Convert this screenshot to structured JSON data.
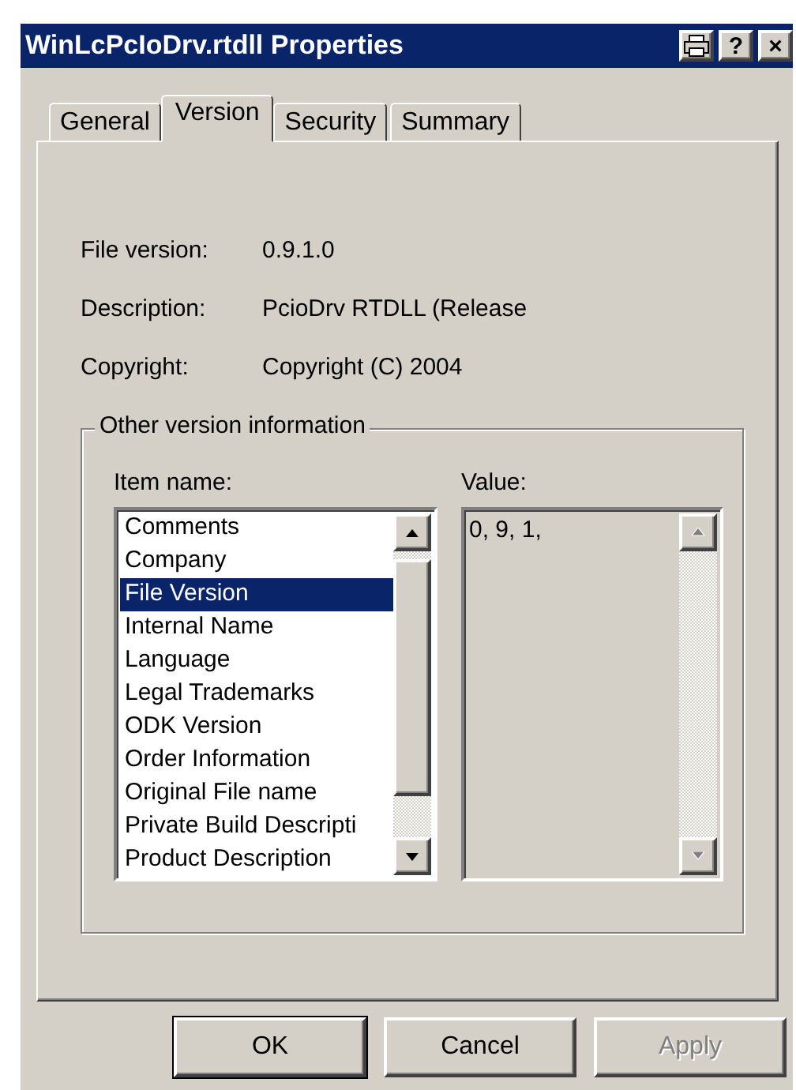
{
  "window": {
    "title": "WinLcPcIoDrv.rtdll Properties",
    "title_buttons": [
      "?",
      "×"
    ]
  },
  "tabs": [
    {
      "label": "General",
      "selected": false
    },
    {
      "label": "Version",
      "selected": true
    },
    {
      "label": "Security",
      "selected": false
    },
    {
      "label": "Summary",
      "selected": false
    }
  ],
  "fields": [
    {
      "label": "File version:",
      "value": "0.9.1.0"
    },
    {
      "label": "Description:",
      "value": "PcioDrv RTDLL (Release"
    },
    {
      "label": "Copyright:",
      "value": "Copyright (C) 2004"
    }
  ],
  "other_info": {
    "title": "Other version information",
    "item_label": "Item name:",
    "value_label": "Value:",
    "items": [
      {
        "label": "Comments",
        "selected": false
      },
      {
        "label": "Company",
        "selected": false
      },
      {
        "label": "File Version",
        "selected": true
      },
      {
        "label": "Internal Name",
        "selected": false
      },
      {
        "label": "Language",
        "selected": false
      },
      {
        "label": "Legal Trademarks",
        "selected": false
      },
      {
        "label": "ODK Version",
        "selected": false
      },
      {
        "label": "Order Information",
        "selected": false
      },
      {
        "label": "Original File name",
        "selected": false
      },
      {
        "label": "Private Build Descripti",
        "selected": false
      },
      {
        "label": "Product Description",
        "selected": false
      }
    ],
    "value": "0, 9, 1,"
  },
  "buttons": [
    {
      "label": "OK",
      "default": true,
      "disabled": false
    },
    {
      "label": "Cancel",
      "default": false,
      "disabled": false
    },
    {
      "label": "Apply",
      "default": false,
      "disabled": true
    }
  ]
}
